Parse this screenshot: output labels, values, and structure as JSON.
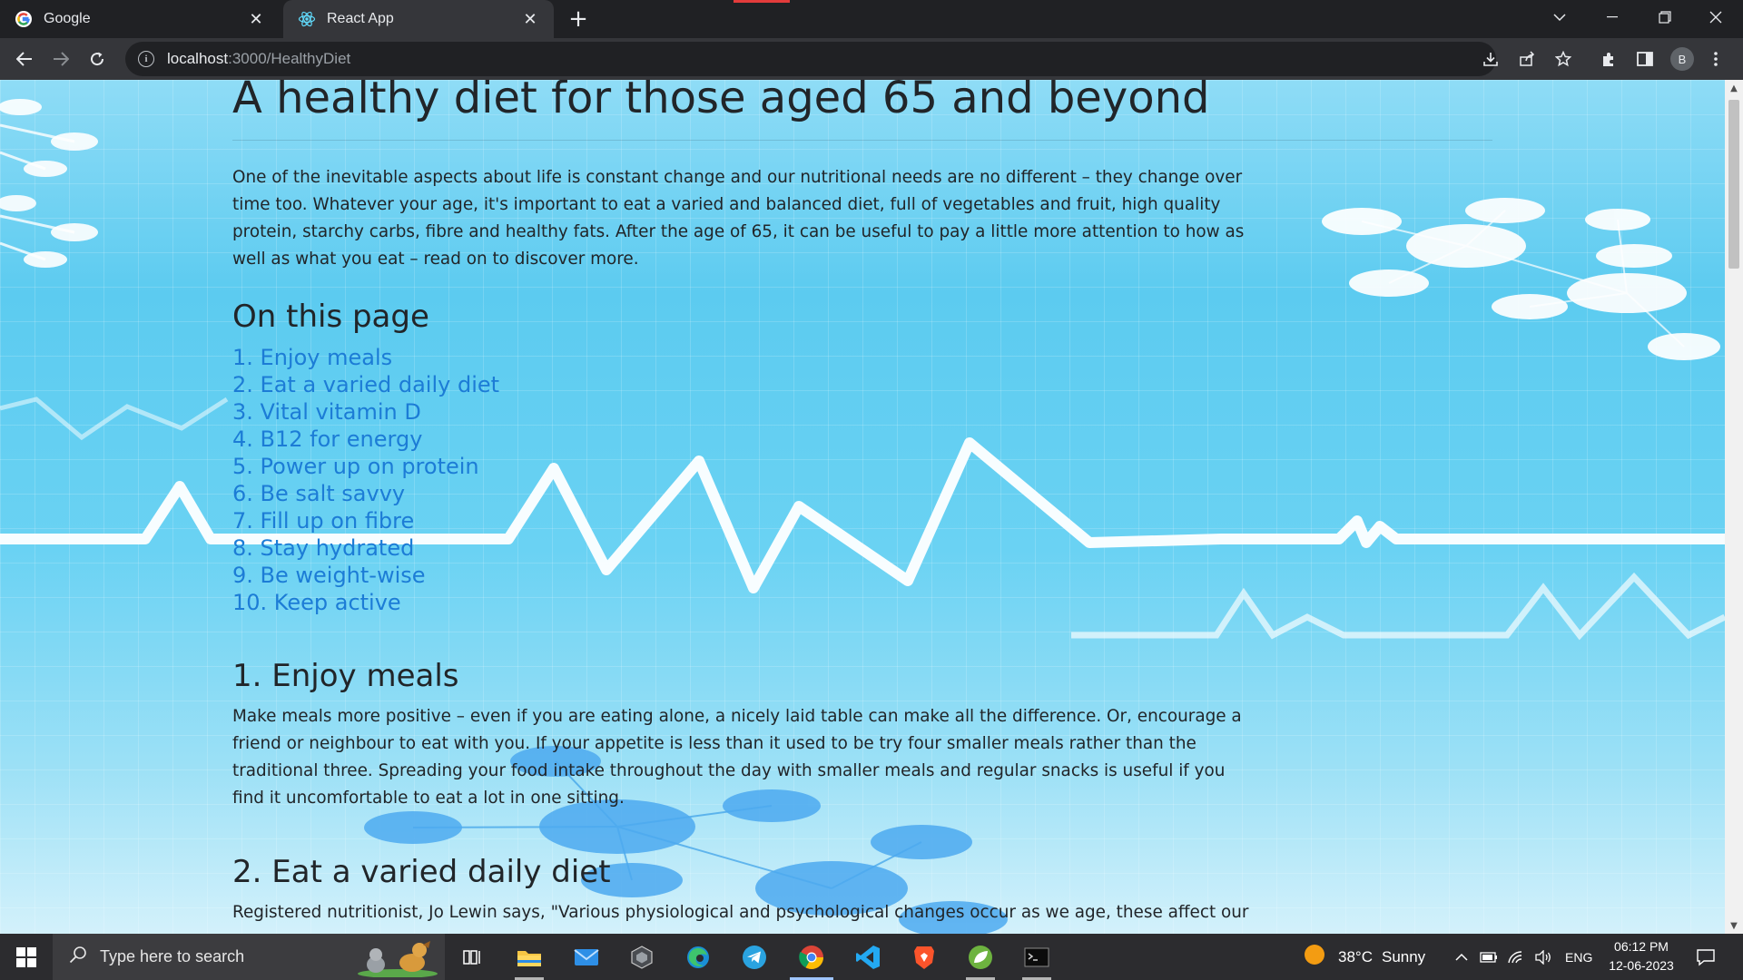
{
  "browser": {
    "tabs": [
      {
        "title": "Google",
        "icon": "google-icon",
        "active": false
      },
      {
        "title": "React App",
        "icon": "react-icon",
        "active": true
      }
    ],
    "address": {
      "host": "localhost",
      "path": ":3000/HealthyDiet"
    },
    "profile_initial": "B"
  },
  "page": {
    "title": "A healthy diet for those aged 65 and beyond",
    "intro": "One of the inevitable aspects about life is constant change and our nutritional needs are no different – they change over time too. Whatever your age, it's important to eat a varied and balanced diet, full of vegetables and fruit, high quality protein, starchy carbs, fibre and healthy fats. After the age of 65, it can be useful to pay a little more attention to how as well as what you eat – read on to discover more.",
    "toc_heading": "On this page",
    "toc": [
      "1. Enjoy meals",
      "2. Eat a varied daily diet",
      "3. Vital vitamin D",
      "4. B12 for energy",
      "5. Power up on protein",
      "6. Be salt savvy",
      "7. Fill up on fibre",
      "8. Stay hydrated",
      "9. Be weight-wise",
      "10. Keep active"
    ],
    "sections": [
      {
        "heading": "1. Enjoy meals",
        "text": "Make meals more positive – even if you are eating alone, a nicely laid table can make all the difference. Or, encourage a friend or neighbour to eat with you. If your appetite is less than it used to be try four smaller meals rather than the traditional three. Spreading your food intake throughout the day with smaller meals and regular snacks is useful if you find it uncomfortable to eat a lot in one sitting."
      },
      {
        "heading": "2. Eat a varied daily diet",
        "text": "Registered nutritionist, Jo Lewin says, \"Various physiological and psychological changes occur as we age, these affect our"
      }
    ],
    "link_color": "#1c7cd6"
  },
  "taskbar": {
    "search_placeholder": "Type here to search",
    "weather": {
      "temp": "38°C",
      "condition": "Sunny"
    },
    "language": "ENG",
    "time": "06:12 PM",
    "date": "12-06-2023",
    "apps": [
      "task-view-icon",
      "file-explorer-icon",
      "mail-icon",
      "app-icon",
      "edge-icon",
      "telegram-icon",
      "chrome-icon",
      "vscode-icon",
      "brave-icon",
      "spring-icon",
      "terminal-icon"
    ]
  }
}
